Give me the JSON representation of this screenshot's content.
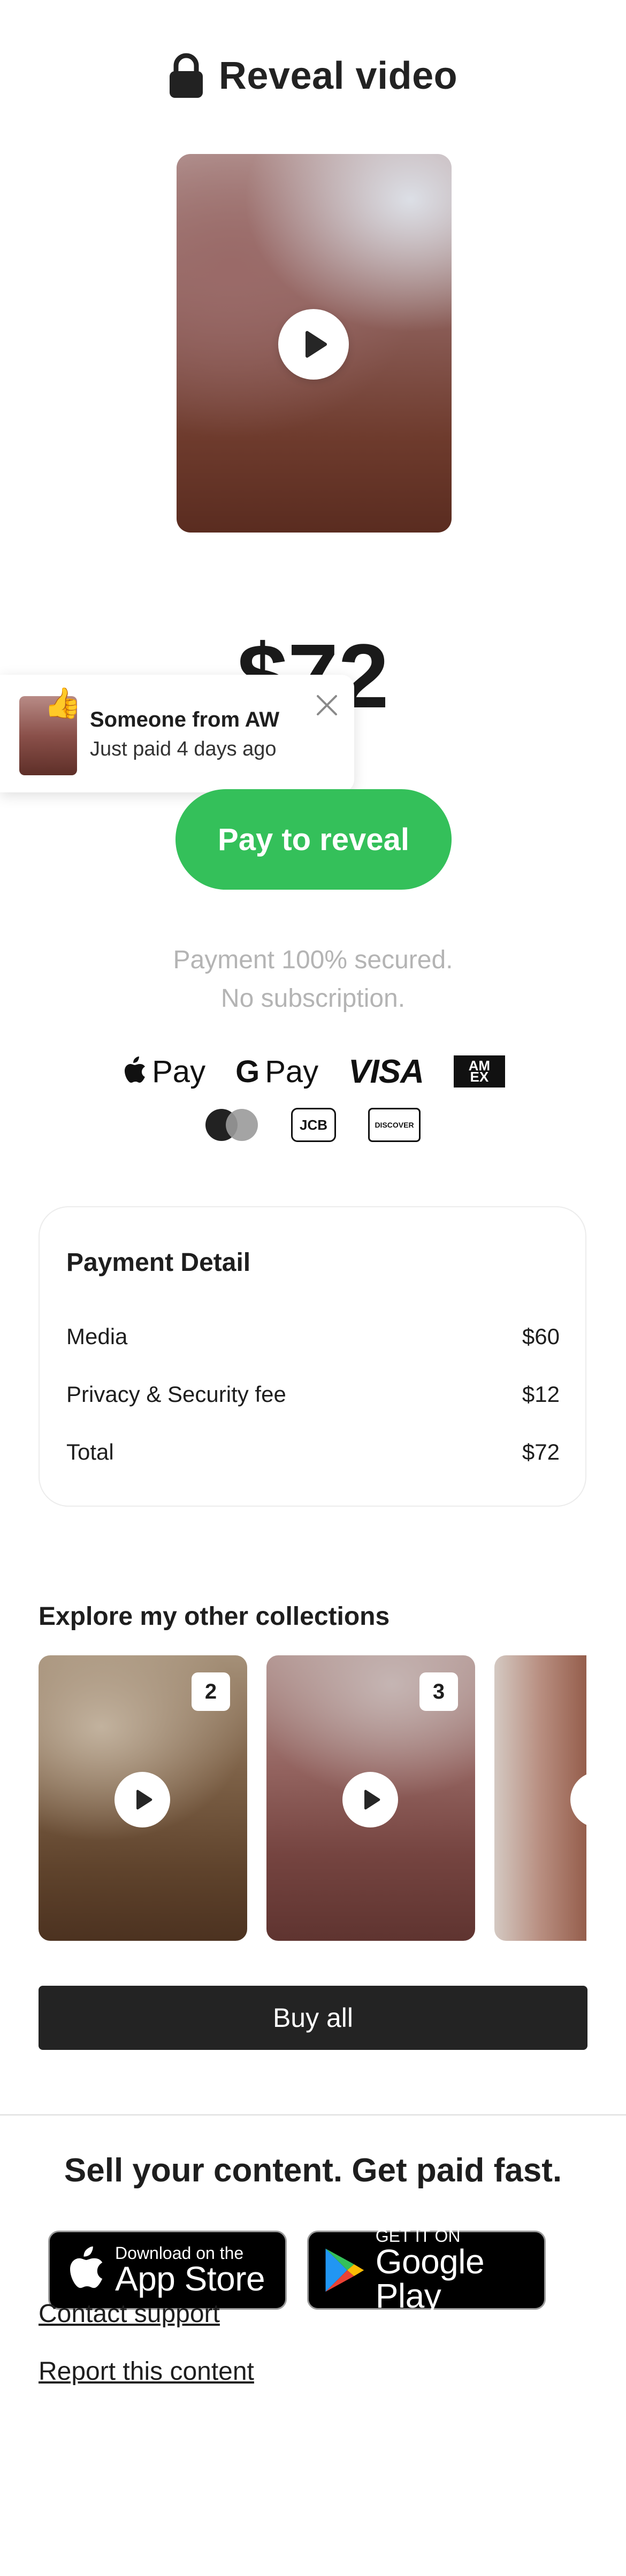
{
  "header": {
    "title": "Reveal video",
    "icon": "lock-icon"
  },
  "hero": {
    "play_icon": "play-icon"
  },
  "price": {
    "amount": "$72"
  },
  "toast": {
    "emoji": "👍",
    "title": "Someone from AW",
    "subtitle": "Just paid 4 days ago",
    "close_icon": "close-icon"
  },
  "pay_button": {
    "label": "Pay to reveal",
    "color": "#34c05a"
  },
  "security": {
    "line1": "Payment 100% secured.",
    "line2": "No subscription."
  },
  "payment_methods": {
    "apple_pay": "Pay",
    "google_pay": "Pay",
    "google_g": "G",
    "visa": "VISA",
    "amex_top": "AM",
    "amex_bottom": "EX",
    "jcb": "JCB",
    "discover": "DISCOVER"
  },
  "payment_detail": {
    "title": "Payment Detail",
    "rows": [
      {
        "label": "Media",
        "value": "$60"
      },
      {
        "label": "Privacy & Security fee",
        "value": "$12"
      },
      {
        "label": "Total",
        "value": "$72"
      }
    ]
  },
  "collections": {
    "title": "Explore my other collections",
    "items": [
      {
        "badge": ""
      },
      {
        "badge": "2"
      },
      {
        "badge": "3"
      }
    ],
    "visible_badges": [
      "2",
      "3"
    ]
  },
  "buy_all": {
    "label": "Buy all"
  },
  "promo": {
    "title": "Sell your content. Get paid fast.",
    "app_store": {
      "small": "Download on the",
      "big": "App Store"
    },
    "google_play": {
      "small": "GET IT ON",
      "big": "Google Play"
    }
  },
  "links": {
    "contact": "Contact support",
    "report": "Report this content"
  }
}
